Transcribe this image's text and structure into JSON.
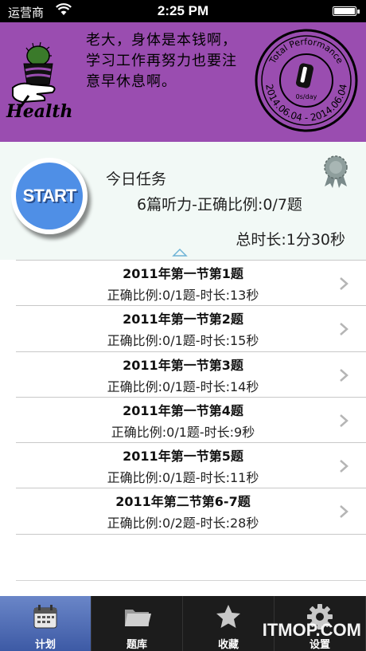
{
  "status_bar": {
    "carrier": "运营商",
    "time": "2:25 PM"
  },
  "header": {
    "logo_text": "Health",
    "motto": "老大，身体是本钱啊，学习工作再努力也要注意早休息啊。",
    "stamp": {
      "top_text": "Total Performance",
      "bottom_text": "2014.06.04 - 2014.06.04",
      "center_text": "0s/day"
    }
  },
  "task": {
    "start_label": "START",
    "title": "今日任务",
    "description": "6篇听力-正确比例:0/7题",
    "total": "总时长:1分30秒"
  },
  "items": [
    {
      "title": "2011年第一节第1题",
      "subtitle": "正确比例:0/1题-时长:13秒"
    },
    {
      "title": "2011年第一节第2题",
      "subtitle": "正确比例:0/1题-时长:15秒"
    },
    {
      "title": "2011年第一节第3题",
      "subtitle": "正确比例:0/1题-时长:14秒"
    },
    {
      "title": "2011年第一节第4题",
      "subtitle": "正确比例:0/1题-时长:9秒"
    },
    {
      "title": "2011年第一节第5题",
      "subtitle": "正确比例:0/1题-时长:11秒"
    },
    {
      "title": "2011年第二节第6-7题",
      "subtitle": "正确比例:0/2题-时长:28秒"
    }
  ],
  "tabs": [
    {
      "label": "计划",
      "icon": "calendar-icon",
      "active": true
    },
    {
      "label": "题库",
      "icon": "folder-icon",
      "active": false
    },
    {
      "label": "收藏",
      "icon": "star-icon",
      "active": false
    },
    {
      "label": "设置",
      "icon": "gear-icon",
      "active": false
    }
  ],
  "watermark": "ITMOP.COM",
  "colors": {
    "header_bg": "#9a4db0",
    "start_blue": "#4f8fe6",
    "task_bg": "#f2f9f6",
    "tab_active": "#4d6cb5"
  }
}
